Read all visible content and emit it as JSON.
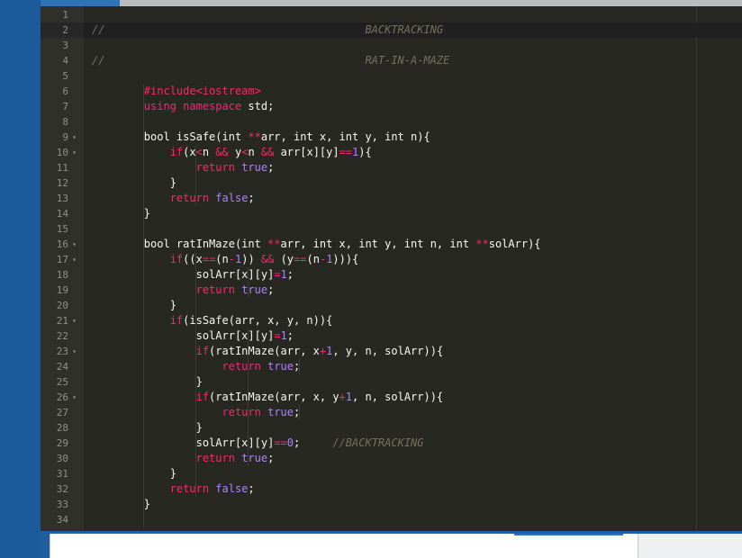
{
  "editor": {
    "lines": [
      {
        "n": "1",
        "fold": false,
        "tokens": []
      },
      {
        "n": "2",
        "fold": false,
        "tokens": [
          {
            "c": "t-com",
            "t": "//"
          },
          {
            "c": "t-com",
            "t": "                                        BACKTRACKING"
          }
        ]
      },
      {
        "n": "3",
        "fold": false,
        "tokens": []
      },
      {
        "n": "4",
        "fold": false,
        "tokens": [
          {
            "c": "t-com",
            "t": "//"
          },
          {
            "c": "t-com",
            "t": "                                        RAT-IN-A-MAZE"
          }
        ]
      },
      {
        "n": "5",
        "fold": false,
        "tokens": []
      },
      {
        "n": "6",
        "fold": false,
        "tokens": [
          {
            "c": "t-plain",
            "t": "        "
          },
          {
            "c": "t-kw",
            "t": "#include"
          },
          {
            "c": "t-kw",
            "t": "<iostream>"
          }
        ]
      },
      {
        "n": "7",
        "fold": false,
        "tokens": [
          {
            "c": "t-plain",
            "t": "        "
          },
          {
            "c": "t-kw",
            "t": "using namespace"
          },
          {
            "c": "t-plain",
            "t": " std;"
          }
        ]
      },
      {
        "n": "8",
        "fold": false,
        "tokens": []
      },
      {
        "n": "9",
        "fold": true,
        "tokens": [
          {
            "c": "t-plain",
            "t": "        bool isSafe(int "
          },
          {
            "c": "t-op",
            "t": "**"
          },
          {
            "c": "t-plain",
            "t": "arr, int x, int y, int n){"
          }
        ]
      },
      {
        "n": "10",
        "fold": true,
        "tokens": [
          {
            "c": "t-plain",
            "t": "            "
          },
          {
            "c": "t-kw",
            "t": "if"
          },
          {
            "c": "t-plain",
            "t": "(x"
          },
          {
            "c": "t-op",
            "t": "<"
          },
          {
            "c": "t-plain",
            "t": "n "
          },
          {
            "c": "t-op",
            "t": "&&"
          },
          {
            "c": "t-plain",
            "t": " y"
          },
          {
            "c": "t-op",
            "t": "<"
          },
          {
            "c": "t-plain",
            "t": "n "
          },
          {
            "c": "t-op",
            "t": "&&"
          },
          {
            "c": "t-plain",
            "t": " arr[x][y]"
          },
          {
            "c": "t-op",
            "t": "=="
          },
          {
            "c": "t-num",
            "t": "1"
          },
          {
            "c": "t-plain",
            "t": "){"
          }
        ]
      },
      {
        "n": "11",
        "fold": false,
        "tokens": [
          {
            "c": "t-plain",
            "t": "                "
          },
          {
            "c": "t-kw",
            "t": "return"
          },
          {
            "c": "t-plain",
            "t": " "
          },
          {
            "c": "t-num",
            "t": "true"
          },
          {
            "c": "t-plain",
            "t": ";"
          }
        ]
      },
      {
        "n": "12",
        "fold": false,
        "tokens": [
          {
            "c": "t-plain",
            "t": "            }"
          }
        ]
      },
      {
        "n": "13",
        "fold": false,
        "tokens": [
          {
            "c": "t-plain",
            "t": "            "
          },
          {
            "c": "t-kw",
            "t": "return"
          },
          {
            "c": "t-plain",
            "t": " "
          },
          {
            "c": "t-num",
            "t": "false"
          },
          {
            "c": "t-plain",
            "t": ";"
          }
        ]
      },
      {
        "n": "14",
        "fold": false,
        "tokens": [
          {
            "c": "t-plain",
            "t": "        }"
          }
        ]
      },
      {
        "n": "15",
        "fold": false,
        "tokens": []
      },
      {
        "n": "16",
        "fold": true,
        "tokens": [
          {
            "c": "t-plain",
            "t": "        bool ratInMaze(int "
          },
          {
            "c": "t-op",
            "t": "**"
          },
          {
            "c": "t-plain",
            "t": "arr, int x, int y, int n, int "
          },
          {
            "c": "t-op",
            "t": "**"
          },
          {
            "c": "t-plain",
            "t": "solArr){"
          }
        ]
      },
      {
        "n": "17",
        "fold": true,
        "tokens": [
          {
            "c": "t-plain",
            "t": "            "
          },
          {
            "c": "t-kw",
            "t": "if"
          },
          {
            "c": "t-plain",
            "t": "((x"
          },
          {
            "c": "t-op",
            "t": "=="
          },
          {
            "c": "t-plain",
            "t": "(n"
          },
          {
            "c": "t-op",
            "t": "-"
          },
          {
            "c": "t-num",
            "t": "1"
          },
          {
            "c": "t-plain",
            "t": ")) "
          },
          {
            "c": "t-op",
            "t": "&&"
          },
          {
            "c": "t-plain",
            "t": " (y"
          },
          {
            "c": "t-op",
            "t": "=="
          },
          {
            "c": "t-plain",
            "t": "(n"
          },
          {
            "c": "t-op",
            "t": "-"
          },
          {
            "c": "t-num",
            "t": "1"
          },
          {
            "c": "t-plain",
            "t": "))){"
          }
        ]
      },
      {
        "n": "18",
        "fold": false,
        "tokens": [
          {
            "c": "t-plain",
            "t": "                solArr[x][y]"
          },
          {
            "c": "t-op",
            "t": "="
          },
          {
            "c": "t-num",
            "t": "1"
          },
          {
            "c": "t-plain",
            "t": ";"
          }
        ]
      },
      {
        "n": "19",
        "fold": false,
        "tokens": [
          {
            "c": "t-plain",
            "t": "                "
          },
          {
            "c": "t-kw",
            "t": "return"
          },
          {
            "c": "t-plain",
            "t": " "
          },
          {
            "c": "t-num",
            "t": "true"
          },
          {
            "c": "t-plain",
            "t": ";"
          }
        ]
      },
      {
        "n": "20",
        "fold": false,
        "tokens": [
          {
            "c": "t-plain",
            "t": "            }"
          }
        ]
      },
      {
        "n": "21",
        "fold": true,
        "tokens": [
          {
            "c": "t-plain",
            "t": "            "
          },
          {
            "c": "t-kw",
            "t": "if"
          },
          {
            "c": "t-plain",
            "t": "(isSafe(arr, x, y, n)){"
          }
        ]
      },
      {
        "n": "22",
        "fold": false,
        "tokens": [
          {
            "c": "t-plain",
            "t": "                solArr[x][y]"
          },
          {
            "c": "t-op",
            "t": "="
          },
          {
            "c": "t-num",
            "t": "1"
          },
          {
            "c": "t-plain",
            "t": ";"
          }
        ]
      },
      {
        "n": "23",
        "fold": true,
        "tokens": [
          {
            "c": "t-plain",
            "t": "                "
          },
          {
            "c": "t-kw",
            "t": "if"
          },
          {
            "c": "t-plain",
            "t": "(ratInMaze(arr, x"
          },
          {
            "c": "t-op",
            "t": "+"
          },
          {
            "c": "t-num",
            "t": "1"
          },
          {
            "c": "t-plain",
            "t": ", y, n, solArr)){"
          }
        ]
      },
      {
        "n": "24",
        "fold": false,
        "tokens": [
          {
            "c": "t-plain",
            "t": "                    "
          },
          {
            "c": "t-kw",
            "t": "return"
          },
          {
            "c": "t-plain",
            "t": " "
          },
          {
            "c": "t-num",
            "t": "true"
          },
          {
            "c": "t-plain",
            "t": ";"
          }
        ]
      },
      {
        "n": "25",
        "fold": false,
        "tokens": [
          {
            "c": "t-plain",
            "t": "                }"
          }
        ]
      },
      {
        "n": "26",
        "fold": true,
        "tokens": [
          {
            "c": "t-plain",
            "t": "                "
          },
          {
            "c": "t-kw",
            "t": "if"
          },
          {
            "c": "t-plain",
            "t": "(ratInMaze(arr, x, y"
          },
          {
            "c": "t-op",
            "t": "+"
          },
          {
            "c": "t-num",
            "t": "1"
          },
          {
            "c": "t-plain",
            "t": ", n, solArr)){"
          }
        ]
      },
      {
        "n": "27",
        "fold": false,
        "tokens": [
          {
            "c": "t-plain",
            "t": "                    "
          },
          {
            "c": "t-kw",
            "t": "return"
          },
          {
            "c": "t-plain",
            "t": " "
          },
          {
            "c": "t-num",
            "t": "true"
          },
          {
            "c": "t-plain",
            "t": ";"
          }
        ]
      },
      {
        "n": "28",
        "fold": false,
        "tokens": [
          {
            "c": "t-plain",
            "t": "                }"
          }
        ]
      },
      {
        "n": "29",
        "fold": false,
        "tokens": [
          {
            "c": "t-plain",
            "t": "                solArr[x][y]"
          },
          {
            "c": "t-op",
            "t": "=="
          },
          {
            "c": "t-num",
            "t": "0"
          },
          {
            "c": "t-plain",
            "t": ";     "
          },
          {
            "c": "t-com",
            "t": "//BACKTRACKING"
          }
        ]
      },
      {
        "n": "30",
        "fold": false,
        "tokens": [
          {
            "c": "t-plain",
            "t": "                "
          },
          {
            "c": "t-kw",
            "t": "return"
          },
          {
            "c": "t-plain",
            "t": " "
          },
          {
            "c": "t-num",
            "t": "true"
          },
          {
            "c": "t-plain",
            "t": ";"
          }
        ]
      },
      {
        "n": "31",
        "fold": false,
        "tokens": [
          {
            "c": "t-plain",
            "t": "            }"
          }
        ]
      },
      {
        "n": "32",
        "fold": false,
        "tokens": [
          {
            "c": "t-plain",
            "t": "            "
          },
          {
            "c": "t-kw",
            "t": "return"
          },
          {
            "c": "t-plain",
            "t": " "
          },
          {
            "c": "t-num",
            "t": "false"
          },
          {
            "c": "t-plain",
            "t": ";"
          }
        ]
      },
      {
        "n": "33",
        "fold": false,
        "tokens": [
          {
            "c": "t-plain",
            "t": "        }"
          }
        ]
      },
      {
        "n": "34",
        "fold": false,
        "tokens": []
      }
    ],
    "active_line": "2",
    "colors": {
      "background": "#272822",
      "gutter": "#2f3129",
      "keyword": "#f92672",
      "number": "#ae81ff",
      "comment": "#75715e",
      "text": "#f8f8f2"
    }
  }
}
